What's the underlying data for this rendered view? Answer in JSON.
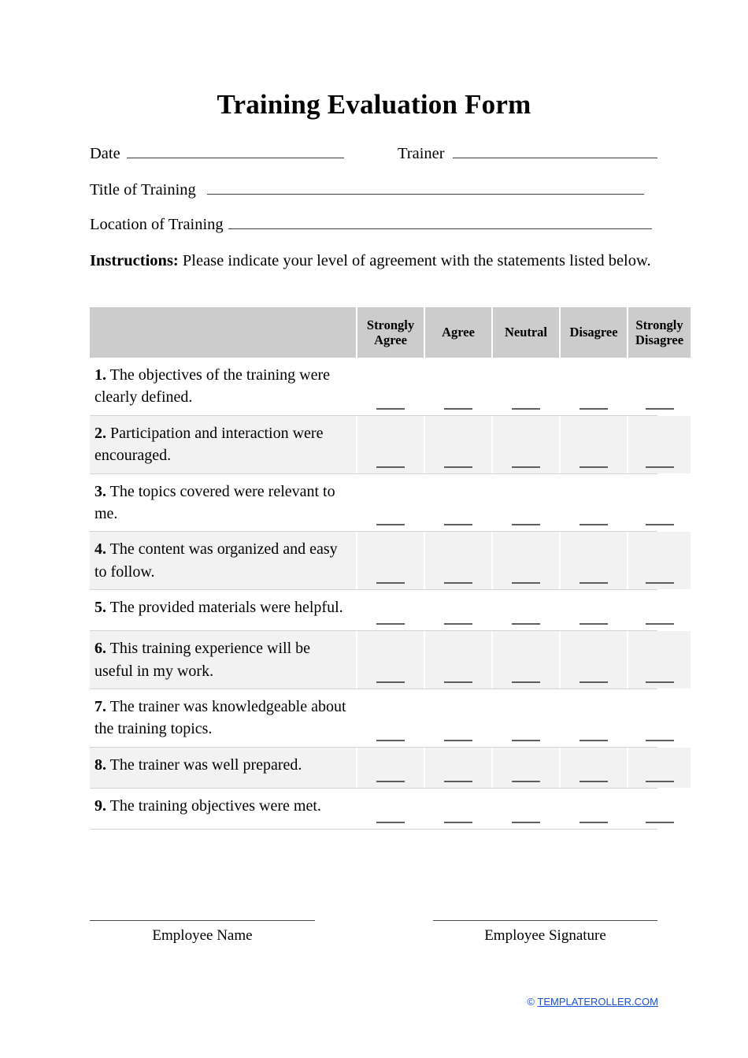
{
  "document": {
    "title": "Training Evaluation Form"
  },
  "fields": {
    "date_label": "Date",
    "trainer_label": "Trainer",
    "title_of_training_label": "Title of Training",
    "location_of_training_label": "Location of Training"
  },
  "instructions": {
    "bold_label": "Instructions:",
    "text": "Please indicate your level of agreement with the statements listed below."
  },
  "table": {
    "headers": {
      "statement_column": "",
      "scale": [
        "Strongly Agree",
        "Agree",
        "Neutral",
        "Disagree",
        "Strongly Disagree"
      ]
    },
    "rows": [
      {
        "number": "1.",
        "statement": "The objectives of the training were clearly defined."
      },
      {
        "number": "2.",
        "statement": "Participation and interaction were encouraged."
      },
      {
        "number": "3.",
        "statement": "The topics covered were relevant to me."
      },
      {
        "number": "4.",
        "statement": "The content was organized and easy to follow."
      },
      {
        "number": "5.",
        "statement": "The provided materials were helpful."
      },
      {
        "number": "6.",
        "statement": "This training experience will be useful in my work."
      },
      {
        "number": "7.",
        "statement": "The trainer was knowledgeable about the training topics."
      },
      {
        "number": "8.",
        "statement": "The trainer was well prepared."
      },
      {
        "number": "9.",
        "statement": "The training objectives were met."
      }
    ]
  },
  "signatures": {
    "employee_name_label": "Employee Name",
    "employee_signature_label": "Employee Signature"
  },
  "footer": {
    "copyright_symbol": "©",
    "site": "TEMPLATEROLLER.COM",
    "link_color": "#1a4fd6"
  }
}
